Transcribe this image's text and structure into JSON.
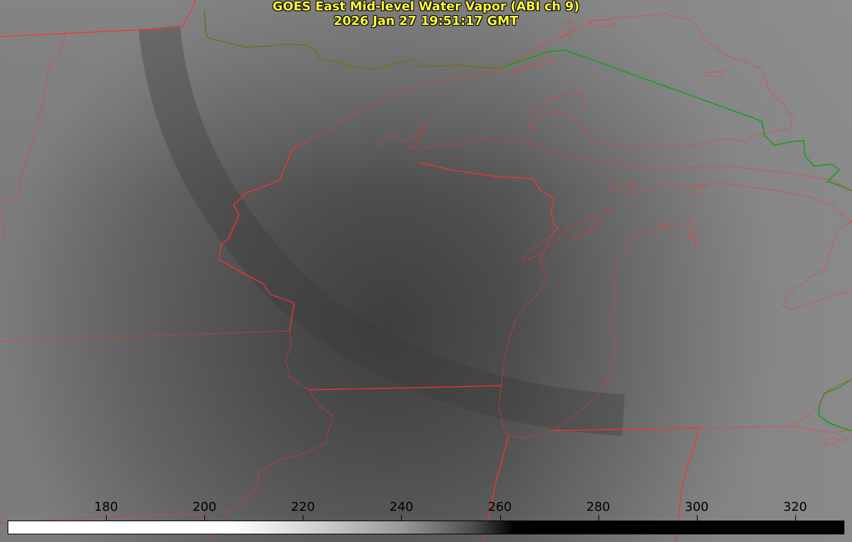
{
  "title": {
    "line1": "GOES East Mid-level Water Vapor (ABI ch 9)",
    "line2": "2026 Jan 27 19:51:17 GMT"
  },
  "colorbar": {
    "min": 160,
    "max": 330,
    "ticks": [
      "180",
      "200",
      "220",
      "240",
      "260",
      "280",
      "300",
      "320"
    ],
    "stops": [
      {
        "value": 160,
        "color": "#ffffff"
      },
      {
        "value": 205,
        "color": "#ffffff"
      },
      {
        "value": 220,
        "color": "#d8d8d8"
      },
      {
        "value": 240,
        "color": "#9a9a9a"
      },
      {
        "value": 255,
        "color": "#4a4a4a"
      },
      {
        "value": 263,
        "color": "#000000"
      },
      {
        "value": 330,
        "color": "#000000"
      }
    ]
  },
  "colors": {
    "state_borders": "#ff3030",
    "country_borders": "#10a010",
    "title_text": "#ffff33"
  }
}
